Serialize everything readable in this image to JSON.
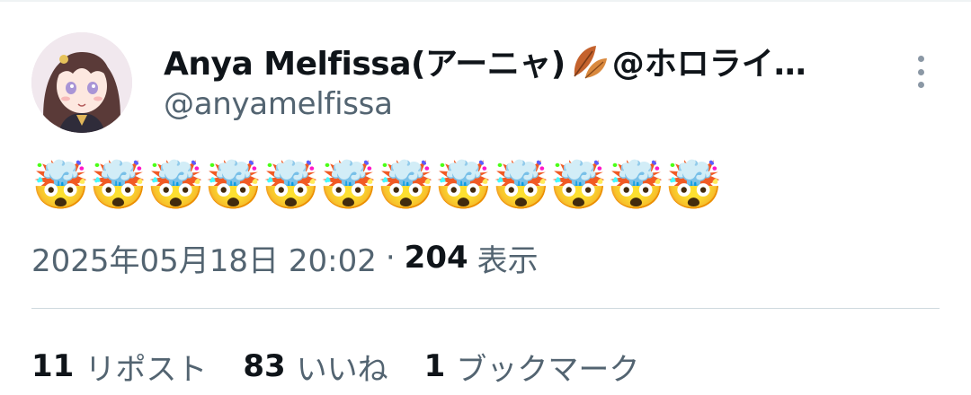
{
  "post": {
    "author": {
      "display_name": "Anya Melfissa(アーニャ)",
      "name_suffix": "@ホロライ…",
      "handle": "@anyamelfissa",
      "name_emoji_icon": "fallen-leaf-icon"
    },
    "text_emoji": [
      "🤯",
      "🤯",
      "🤯",
      "🤯",
      "🤯",
      "🤯",
      "🤯",
      "🤯",
      "🤯",
      "🤯",
      "🤯",
      "🤯"
    ],
    "timestamp": "2025年05月18日 20:02",
    "separator": "·",
    "views_count": "204",
    "views_label": "表示",
    "stats": {
      "reposts_count": "11",
      "reposts_label": "リポスト",
      "likes_count": "83",
      "likes_label": "いいね",
      "bookmarks_count": "1",
      "bookmarks_label": "ブックマーク"
    },
    "colors": {
      "primary_text": "#0f1419",
      "secondary_text": "#536471",
      "divider": "#cfd9de"
    }
  }
}
